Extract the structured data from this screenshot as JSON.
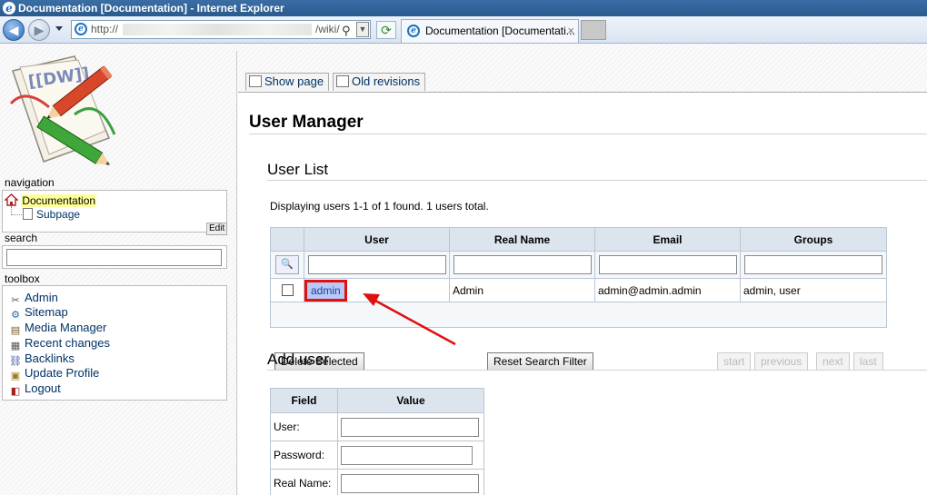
{
  "window": {
    "title": "Documentation [Documentation] - Internet Explorer"
  },
  "toolbar": {
    "url_prefix": "http://",
    "url_suffix": "/wiki/",
    "tab_title": "Documentation [Documentati...",
    "tab_close": "×"
  },
  "sidebar": {
    "nav_heading": "navigation",
    "nav_items": [
      {
        "label": "Documentation"
      },
      {
        "label": "Subpage"
      }
    ],
    "edit_label": "Edit",
    "search_heading": "search",
    "toolbox_heading": "toolbox",
    "toolbox_items": [
      {
        "label": "Admin",
        "icon": "admin-icon"
      },
      {
        "label": "Sitemap",
        "icon": "sitemap-icon"
      },
      {
        "label": "Media Manager",
        "icon": "media-icon"
      },
      {
        "label": "Recent changes",
        "icon": "recent-changes-icon"
      },
      {
        "label": "Backlinks",
        "icon": "backlinks-icon"
      },
      {
        "label": "Update Profile",
        "icon": "profile-icon"
      },
      {
        "label": "Logout",
        "icon": "logout-icon"
      }
    ]
  },
  "page_tabs": {
    "show_page": "Show page",
    "old_revisions": "Old revisions"
  },
  "main": {
    "title": "User Manager",
    "user_list_heading": "User List",
    "info": "Displaying users 1-1 of 1 found. 1 users total.",
    "columns": [
      "User",
      "Real Name",
      "Email",
      "Groups"
    ],
    "rows": [
      {
        "user": "admin",
        "real_name": "Admin",
        "email": "admin@admin.admin",
        "groups": "admin, user"
      }
    ],
    "buttons": {
      "delete_selected": "Delete Selected",
      "reset_filter": "Reset Search Filter",
      "start": "start",
      "previous": "previous",
      "next": "next",
      "last": "last"
    },
    "add_user_heading": "Add user",
    "add_columns": [
      "Field",
      "Value"
    ],
    "add_fields": [
      {
        "label": "User:"
      },
      {
        "label": "Password:"
      },
      {
        "label": "Real Name:"
      }
    ]
  },
  "colors": {
    "highlight_box": "#e01010",
    "admin_link_bg": "#b7c9f5",
    "table_header": "#dce5ee"
  }
}
